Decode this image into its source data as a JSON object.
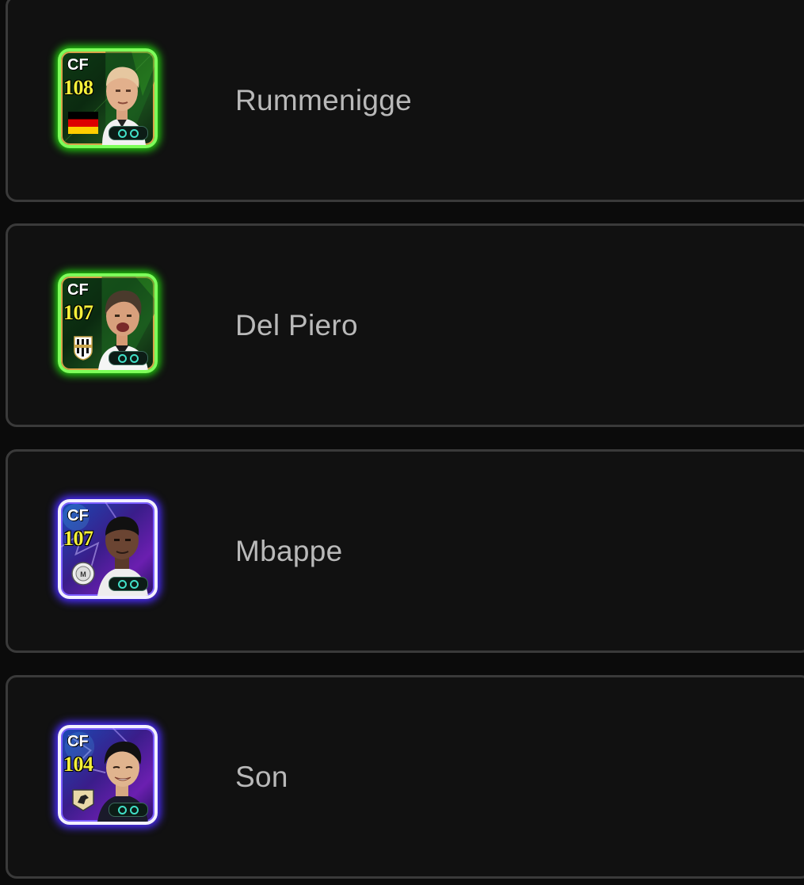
{
  "players": [
    {
      "name": "Rummenigge",
      "card": {
        "position": "CF",
        "rating": "108",
        "theme": "green",
        "emblem": "germany-flag-icon"
      }
    },
    {
      "name": "Del Piero",
      "card": {
        "position": "CF",
        "rating": "107",
        "theme": "green",
        "emblem": "club-crest-icon"
      }
    },
    {
      "name": "Mbappe",
      "card": {
        "position": "CF",
        "rating": "107",
        "theme": "purple",
        "emblem": "club-crest-icon"
      }
    },
    {
      "name": "Son",
      "card": {
        "position": "CF",
        "rating": "104",
        "theme": "purple",
        "emblem": "club-crest-icon"
      }
    }
  ],
  "colors": {
    "background": "#0b0b0b",
    "row_background": "#111111",
    "row_border": "#3a3a3a",
    "name_text": "#b9b9b9",
    "rating_text": "#f5f03a",
    "green_glow": "#24d80f",
    "purple_glow": "#4b2dff"
  }
}
